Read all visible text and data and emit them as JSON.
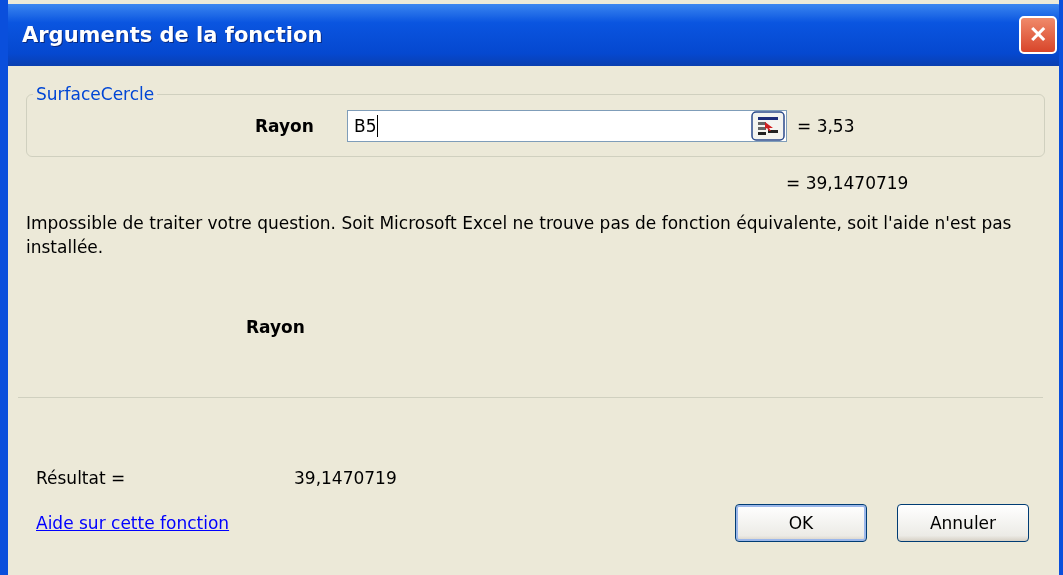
{
  "window": {
    "title": "Arguments de la fonction",
    "close": "✕"
  },
  "function_group": {
    "legend": "SurfaceCercle",
    "arguments": [
      {
        "label": "Rayon",
        "value": "B5",
        "result": "= 3,53"
      }
    ]
  },
  "formula_result": "= 39,1470719",
  "description": "Impossible de traiter votre question. Soit Microsoft Excel ne trouve pas de fonction équivalente, soit l'aide n'est pas installée.",
  "argument_help": {
    "name": "Rayon"
  },
  "result": {
    "label": "Résultat =",
    "value": "39,1470719"
  },
  "help_link": "Aide sur cette fonction",
  "buttons": [
    {
      "label": "OK",
      "kind": "default"
    },
    {
      "label": "Annuler",
      "kind": "normal"
    }
  ]
}
